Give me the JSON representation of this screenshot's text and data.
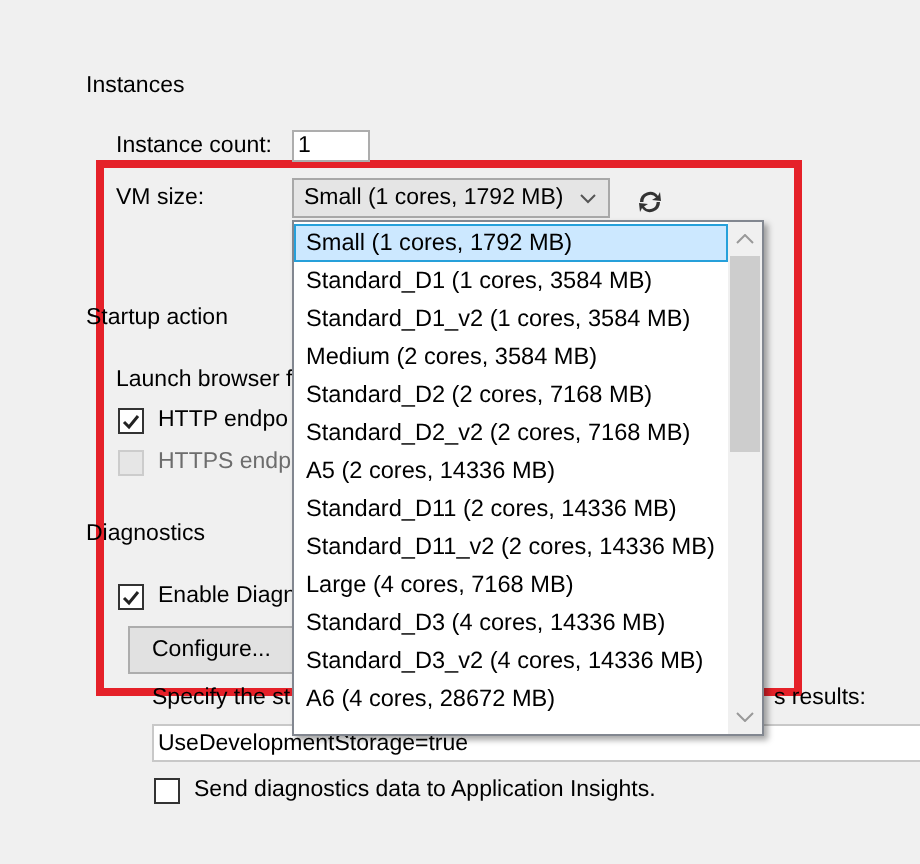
{
  "instances": {
    "title": "Instances",
    "count_label": "Instance count:",
    "count_value": "1"
  },
  "vm_size": {
    "label": "VM size:",
    "value": "Small (1 cores, 1792 MB)",
    "expanded": true,
    "options": [
      {
        "label": "Small (1 cores, 1792 MB)",
        "selected": true
      },
      {
        "label": "Standard_D1 (1 cores, 3584 MB)",
        "selected": false
      },
      {
        "label": "Standard_D1_v2 (1 cores, 3584 MB)",
        "selected": false
      },
      {
        "label": "Medium (2 cores, 3584 MB)",
        "selected": false
      },
      {
        "label": "Standard_D2 (2 cores, 7168 MB)",
        "selected": false
      },
      {
        "label": "Standard_D2_v2 (2 cores, 7168 MB)",
        "selected": false
      },
      {
        "label": "A5 (2 cores, 14336 MB)",
        "selected": false
      },
      {
        "label": "Standard_D11 (2 cores, 14336 MB)",
        "selected": false
      },
      {
        "label": "Standard_D11_v2 (2 cores, 14336 MB)",
        "selected": false
      },
      {
        "label": "Large (4 cores, 7168 MB)",
        "selected": false
      },
      {
        "label": "Standard_D3 (4 cores, 14336 MB)",
        "selected": false
      },
      {
        "label": "Standard_D3_v2 (4 cores, 14336 MB)",
        "selected": false
      },
      {
        "label": "A6 (4 cores, 28672 MB)",
        "selected": false
      }
    ]
  },
  "startup": {
    "title": "Startup action",
    "launch_label": "Launch browser f",
    "checkboxes": [
      {
        "label": "HTTP endpo",
        "checked": true,
        "disabled": false
      },
      {
        "label": "HTTPS endp",
        "checked": false,
        "disabled": true
      }
    ]
  },
  "diagnostics": {
    "title": "Diagnostics",
    "enable": {
      "label": "Enable Diagn",
      "checked": true
    },
    "configure_button": "Configure...",
    "specify_left": "Specify the st",
    "specify_right": "s results:",
    "storage_value": "UseDevelopmentStorage=true",
    "insights": {
      "label": "Send diagnostics data to Application Insights.",
      "checked": false
    }
  }
}
